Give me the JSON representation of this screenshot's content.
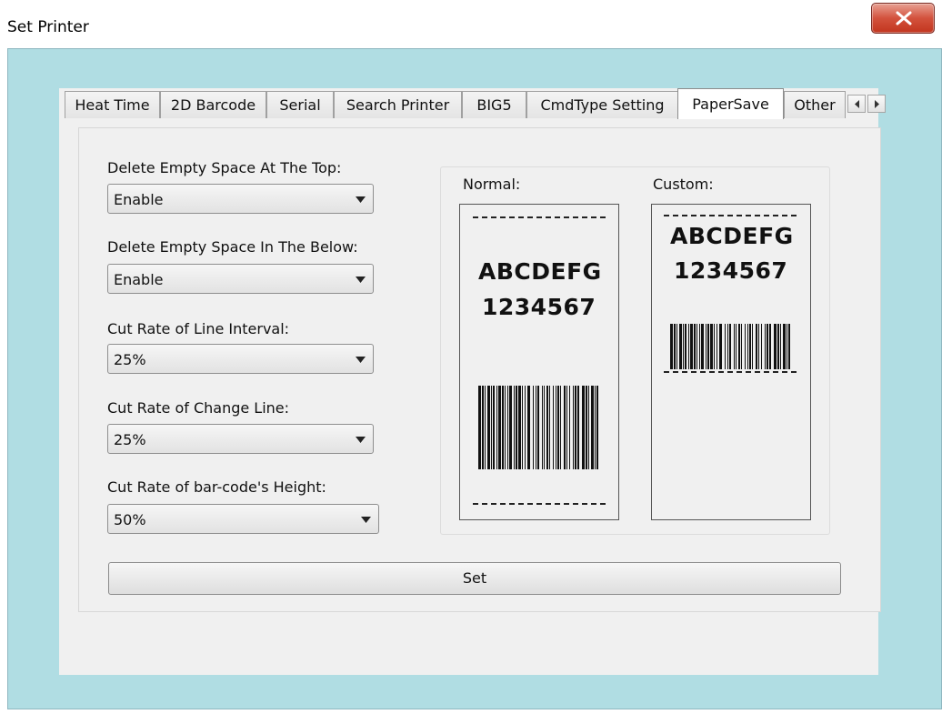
{
  "window": {
    "title": "Set Printer",
    "close_icon": "close-icon"
  },
  "tabs": [
    {
      "label": "Heat Time",
      "active": false
    },
    {
      "label": "2D Barcode",
      "active": false
    },
    {
      "label": "Serial",
      "active": false
    },
    {
      "label": "Search Printer",
      "active": false
    },
    {
      "label": "BIG5",
      "active": false
    },
    {
      "label": "CmdType Setting",
      "active": false
    },
    {
      "label": "PaperSave",
      "active": true
    },
    {
      "label": "Other",
      "active": false
    }
  ],
  "tab_scroll": {
    "left_icon": "arrow-left-icon",
    "right_icon": "arrow-right-icon"
  },
  "fields": [
    {
      "label": "Delete Empty Space At The Top:",
      "value": "Enable"
    },
    {
      "label": "Delete Empty Space In The Below:",
      "value": "Enable"
    },
    {
      "label": "Cut Rate of Line Interval:",
      "value": "25%"
    },
    {
      "label": "Cut Rate of Change Line:",
      "value": "25%"
    },
    {
      "label": "Cut Rate of bar-code's Height:",
      "value": "50%"
    }
  ],
  "preview": {
    "normal": {
      "label": "Normal:",
      "line1": "ABCDEFG",
      "line2": "1234567"
    },
    "custom": {
      "label": "Custom:",
      "line1": "ABCDEFG",
      "line2": "1234567"
    }
  },
  "actions": {
    "set_label": "Set"
  },
  "colors": {
    "frame": "#b0dde3",
    "close_button": "#c9452f"
  }
}
